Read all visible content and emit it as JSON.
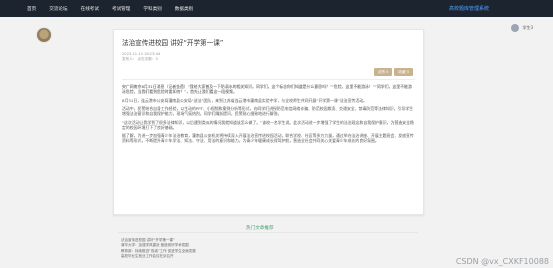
{
  "nav": {
    "items": [
      "首页",
      "交流论坛",
      "在线考试",
      "考试管理",
      "学科类别",
      "数据类别"
    ],
    "brand": "高校题库管理系统"
  },
  "user": {
    "name": "学生3"
  },
  "article": {
    "title": "法治宣传进校园 讲好“开学第一课”",
    "meta": [
      "2023-11-14 16:13:44",
      "发布人：    点击次数：3"
    ],
    "actions": [
      "点赞 0",
      "收藏 0"
    ],
    "paragraphs": [
      "央广网南京8月31日消息（记者金蓓）“我给大家普及一下防溺水的相关知识。同学们，这个标志你们知道是什么意思吗？”“危险，这里不能游泳！”“同学们，这里不能游泳危险，当我们看到危险时要如何？”，首先让我们看这一段视频。",
      "8月31日，连云港市公安局灌南县公安局“送法”团队，来到江苏省连云港市灌南县实验中学，与全校师生共同开展“开学第一课”法治宣传活动。",
      "活动中，民警结合自身工作经验，以生动的PPT、小视频和案例分析等形式，向同学们讲授防范电信网络诈骗、防范校园欺凌、交通安全、禁毒防范等法律知识，引导学生增强法治意识和自我保护能力。现场气氛热烈，同学们踊跃提问，民警耐心细致地进行解答。",
      "“这次活动让我学到了很多法律知识，以后遇到类似的情况我就知道该怎么做了。”该校一名学生说。此次活动进一步增强了学生的法治观念和自我保护意识，为营造安全稳定的校园环境打下了良好基础。",
      "据了解，为进一步加强青少年法治教育，灌南县公安机关将持续深入开展法治宣传进校园活动，联合学校、社区等多方力量，通过举办法治讲座、开展主题班会、发放宣传资料等形式，不断提升青少年学法、知法、守法、用法的意识和能力，为青少年健康成长保驾护航，营造全社会共同关心关爱青少年成长的良好氛围。"
    ]
  },
  "hot": {
    "title": "热门文章推荐",
    "items": [
      "法治宣传进校园 讲好“开学第一课”",
      "清华大学：加强学风建设 营造良好学术氛围",
      "教育部：持续推进“双减”工作 促进学生全面发展",
      "高校毕业生就业工作会议在京召开"
    ]
  },
  "watermark": "CSDN @vx_CXKF10088"
}
